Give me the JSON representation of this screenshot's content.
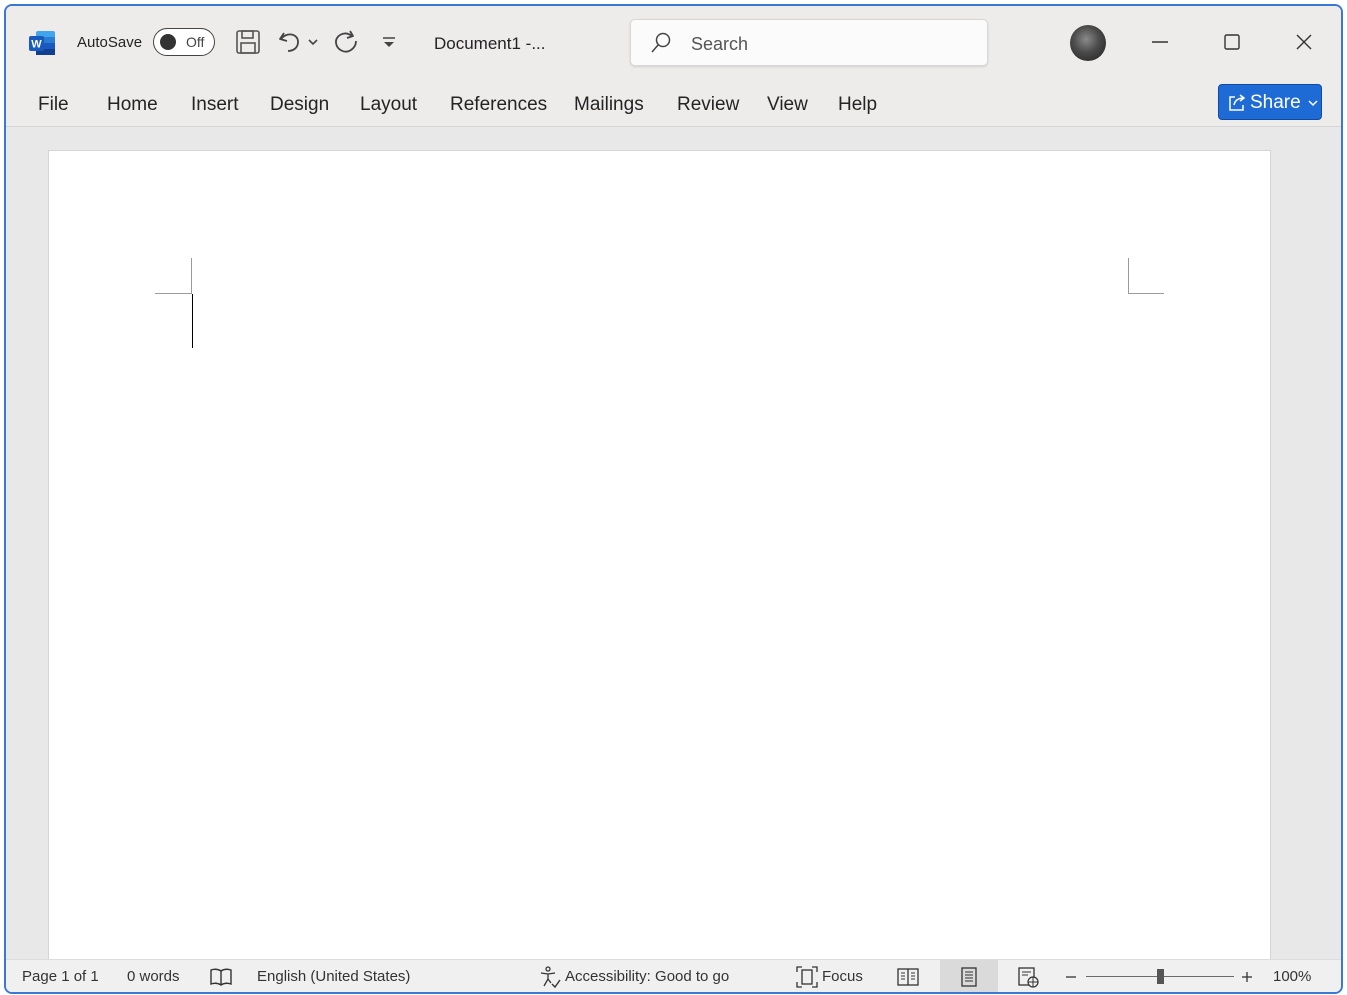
{
  "app": {
    "brand_color": "#2b579a",
    "accent": "#1f6bd6",
    "logo_icon": "word-logo"
  },
  "titlebar": {
    "autosave_label": "AutoSave",
    "autosave_state": "Off",
    "document_title": "Document1  -...",
    "search_placeholder": "Search"
  },
  "menu": {
    "items": [
      "File",
      "Home",
      "Insert",
      "Design",
      "Layout",
      "References",
      "Mailings",
      "Review",
      "View",
      "Help"
    ],
    "share_label": "Share"
  },
  "status": {
    "page": "Page 1 of 1",
    "words": "0 words",
    "language": "English (United States)",
    "accessibility": "Accessibility: Good to go",
    "focus": "Focus",
    "zoom": "100%"
  }
}
